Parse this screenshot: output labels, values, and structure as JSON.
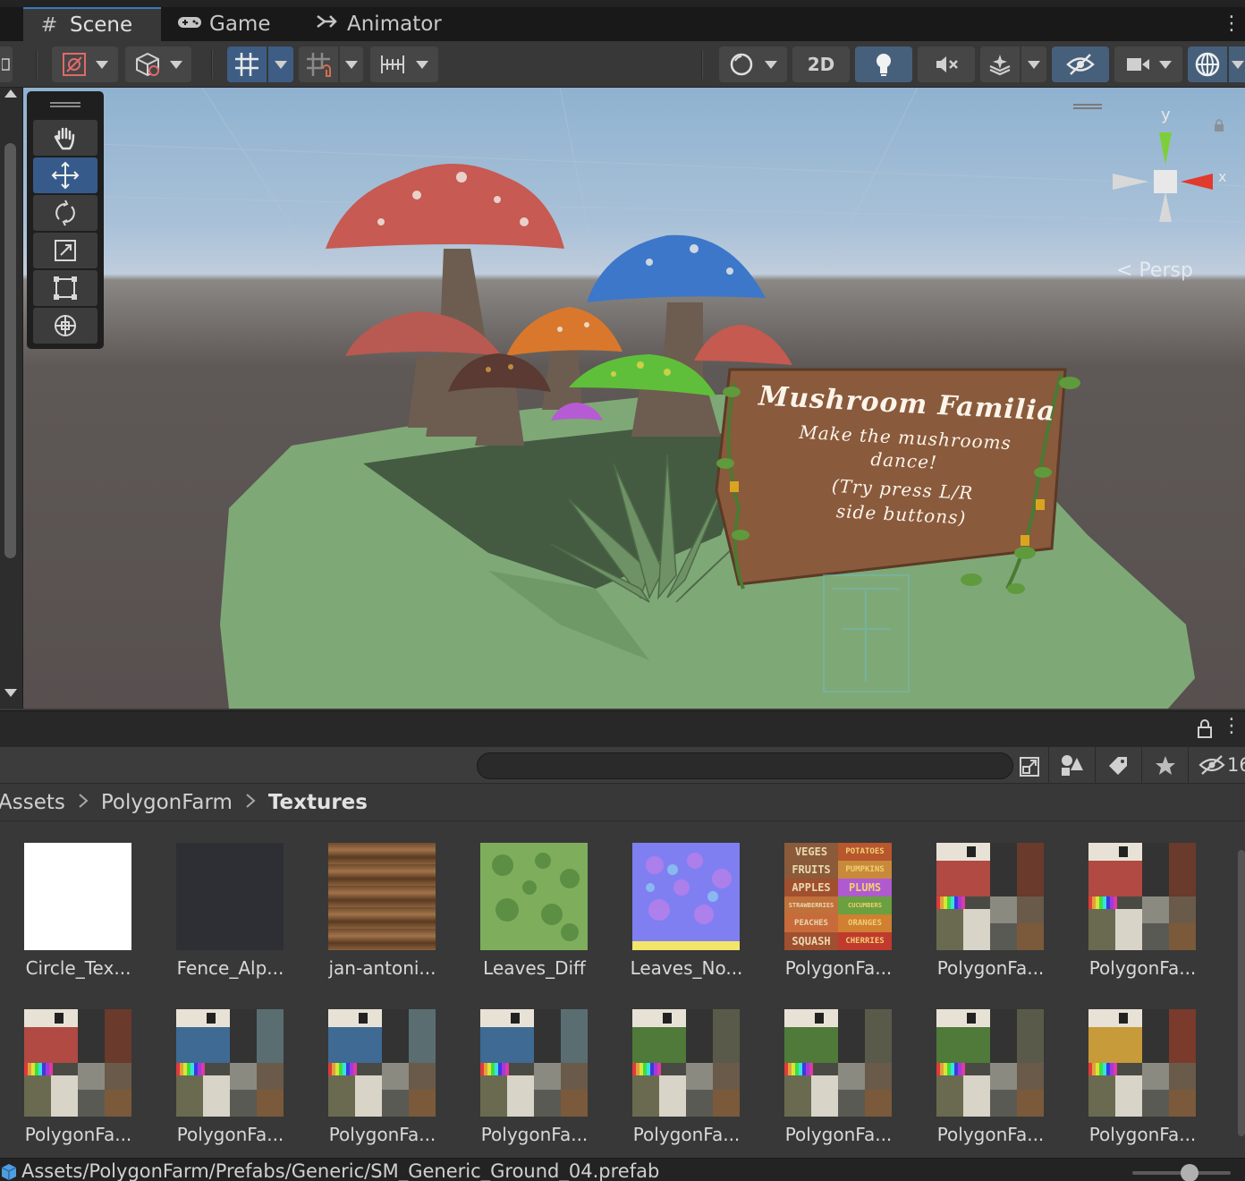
{
  "tabs": [
    {
      "label": "Scene",
      "icon": "grid-icon"
    },
    {
      "label": "Game",
      "icon": "gamepad-icon"
    },
    {
      "label": "Animator",
      "icon": "animator-icon"
    }
  ],
  "toolbar": {
    "mode_2d_label": "2D"
  },
  "scene": {
    "projection_label": "< Persp",
    "axis_y": "y",
    "axis_x": "x",
    "sign": {
      "title": "Mushroom Familia",
      "line1": "Make the mushrooms",
      "line2": "dance!",
      "line3": "(Try press L/R",
      "line4": "side buttons)"
    },
    "colors": {
      "ground": "#7fa877",
      "mushroom_red": "#c75a52",
      "mushroom_blue": "#3d77c9",
      "mushroom_orange": "#d9782c",
      "mushroom_green": "#5fbf3a",
      "mushroom_purple": "#b65bd3",
      "stem": "#6d5d50",
      "sign": "#8a5a3c"
    }
  },
  "project": {
    "search_placeholder": "",
    "hidden_count": "16",
    "breadcrumb": [
      "Assets",
      "PolygonFarm",
      "Textures"
    ],
    "assets_row1": [
      {
        "label": "Circle_Tex...",
        "thumb": "white"
      },
      {
        "label": "Fence_Alp...",
        "thumb": "dark"
      },
      {
        "label": "jan-antoni...",
        "thumb": "wood"
      },
      {
        "label": "Leaves_Diff",
        "thumb": "leaves"
      },
      {
        "label": "Leaves_No...",
        "thumb": "normal"
      },
      {
        "label": "PolygonFa...",
        "thumb": "signs"
      },
      {
        "label": "PolygonFa...",
        "thumb": "atlas-red"
      },
      {
        "label": "PolygonFa...",
        "thumb": "atlas-red"
      }
    ],
    "assets_row2": [
      {
        "label": "PolygonFa...",
        "thumb": "atlas-red"
      },
      {
        "label": "PolygonFa...",
        "thumb": "atlas-blue"
      },
      {
        "label": "PolygonFa...",
        "thumb": "atlas-blue"
      },
      {
        "label": "PolygonFa...",
        "thumb": "atlas-blue"
      },
      {
        "label": "PolygonFa...",
        "thumb": "atlas-green"
      },
      {
        "label": "PolygonFa...",
        "thumb": "atlas-green"
      },
      {
        "label": "PolygonFa...",
        "thumb": "atlas-green"
      },
      {
        "label": "PolygonFa...",
        "thumb": "atlas-yellow"
      }
    ],
    "sign_texture_words": [
      "VEGES",
      "POTATOES",
      "FRUITS",
      "PUMPKINS",
      "APPLES",
      "PLUMS",
      "STRAWBERRIES",
      "CUCUMBERS",
      "PEACHES",
      "ORANGES",
      "SQUASH",
      "CHERRIES"
    ]
  },
  "statusbar": {
    "path": "Assets/PolygonFarm/Prefabs/Generic/SM_Generic_Ground_04.prefab"
  }
}
